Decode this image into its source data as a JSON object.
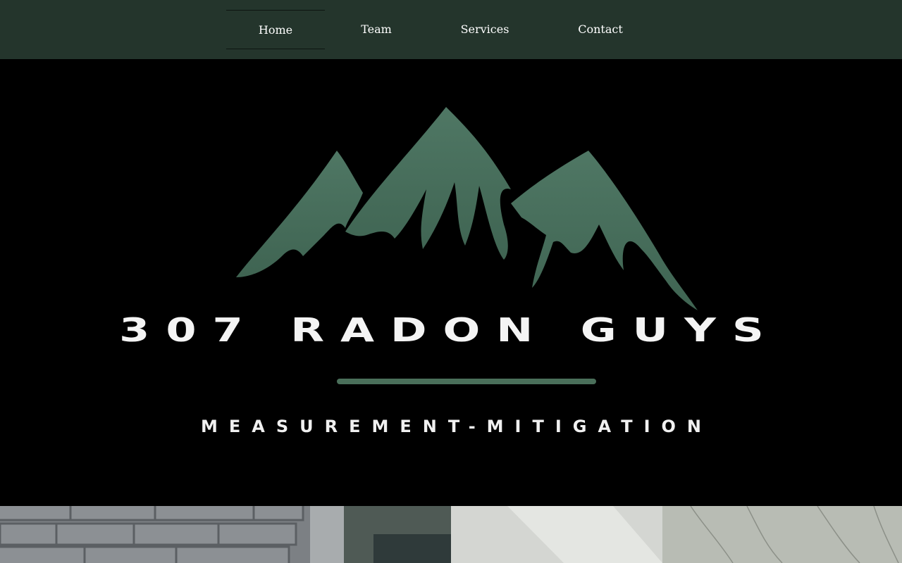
{
  "nav": {
    "items": [
      {
        "label": "Home",
        "active": true
      },
      {
        "label": "Team",
        "active": false
      },
      {
        "label": "Services",
        "active": false
      },
      {
        "label": "Contact",
        "active": false
      }
    ]
  },
  "hero": {
    "brand_name": "307 RADON GUYS",
    "tagline": "MEASUREMENT-MITIGATION",
    "logo_icon": "mountain-range-icon"
  },
  "colors": {
    "nav_background": "#24352c",
    "hero_background": "#000000",
    "accent_green": "#4a6f5a",
    "text_light": "#ffffff"
  },
  "gallery": [
    {
      "description_icon": "house-exterior-brick-photo"
    },
    {
      "description_icon": "house-exterior-siding-photo"
    }
  ]
}
